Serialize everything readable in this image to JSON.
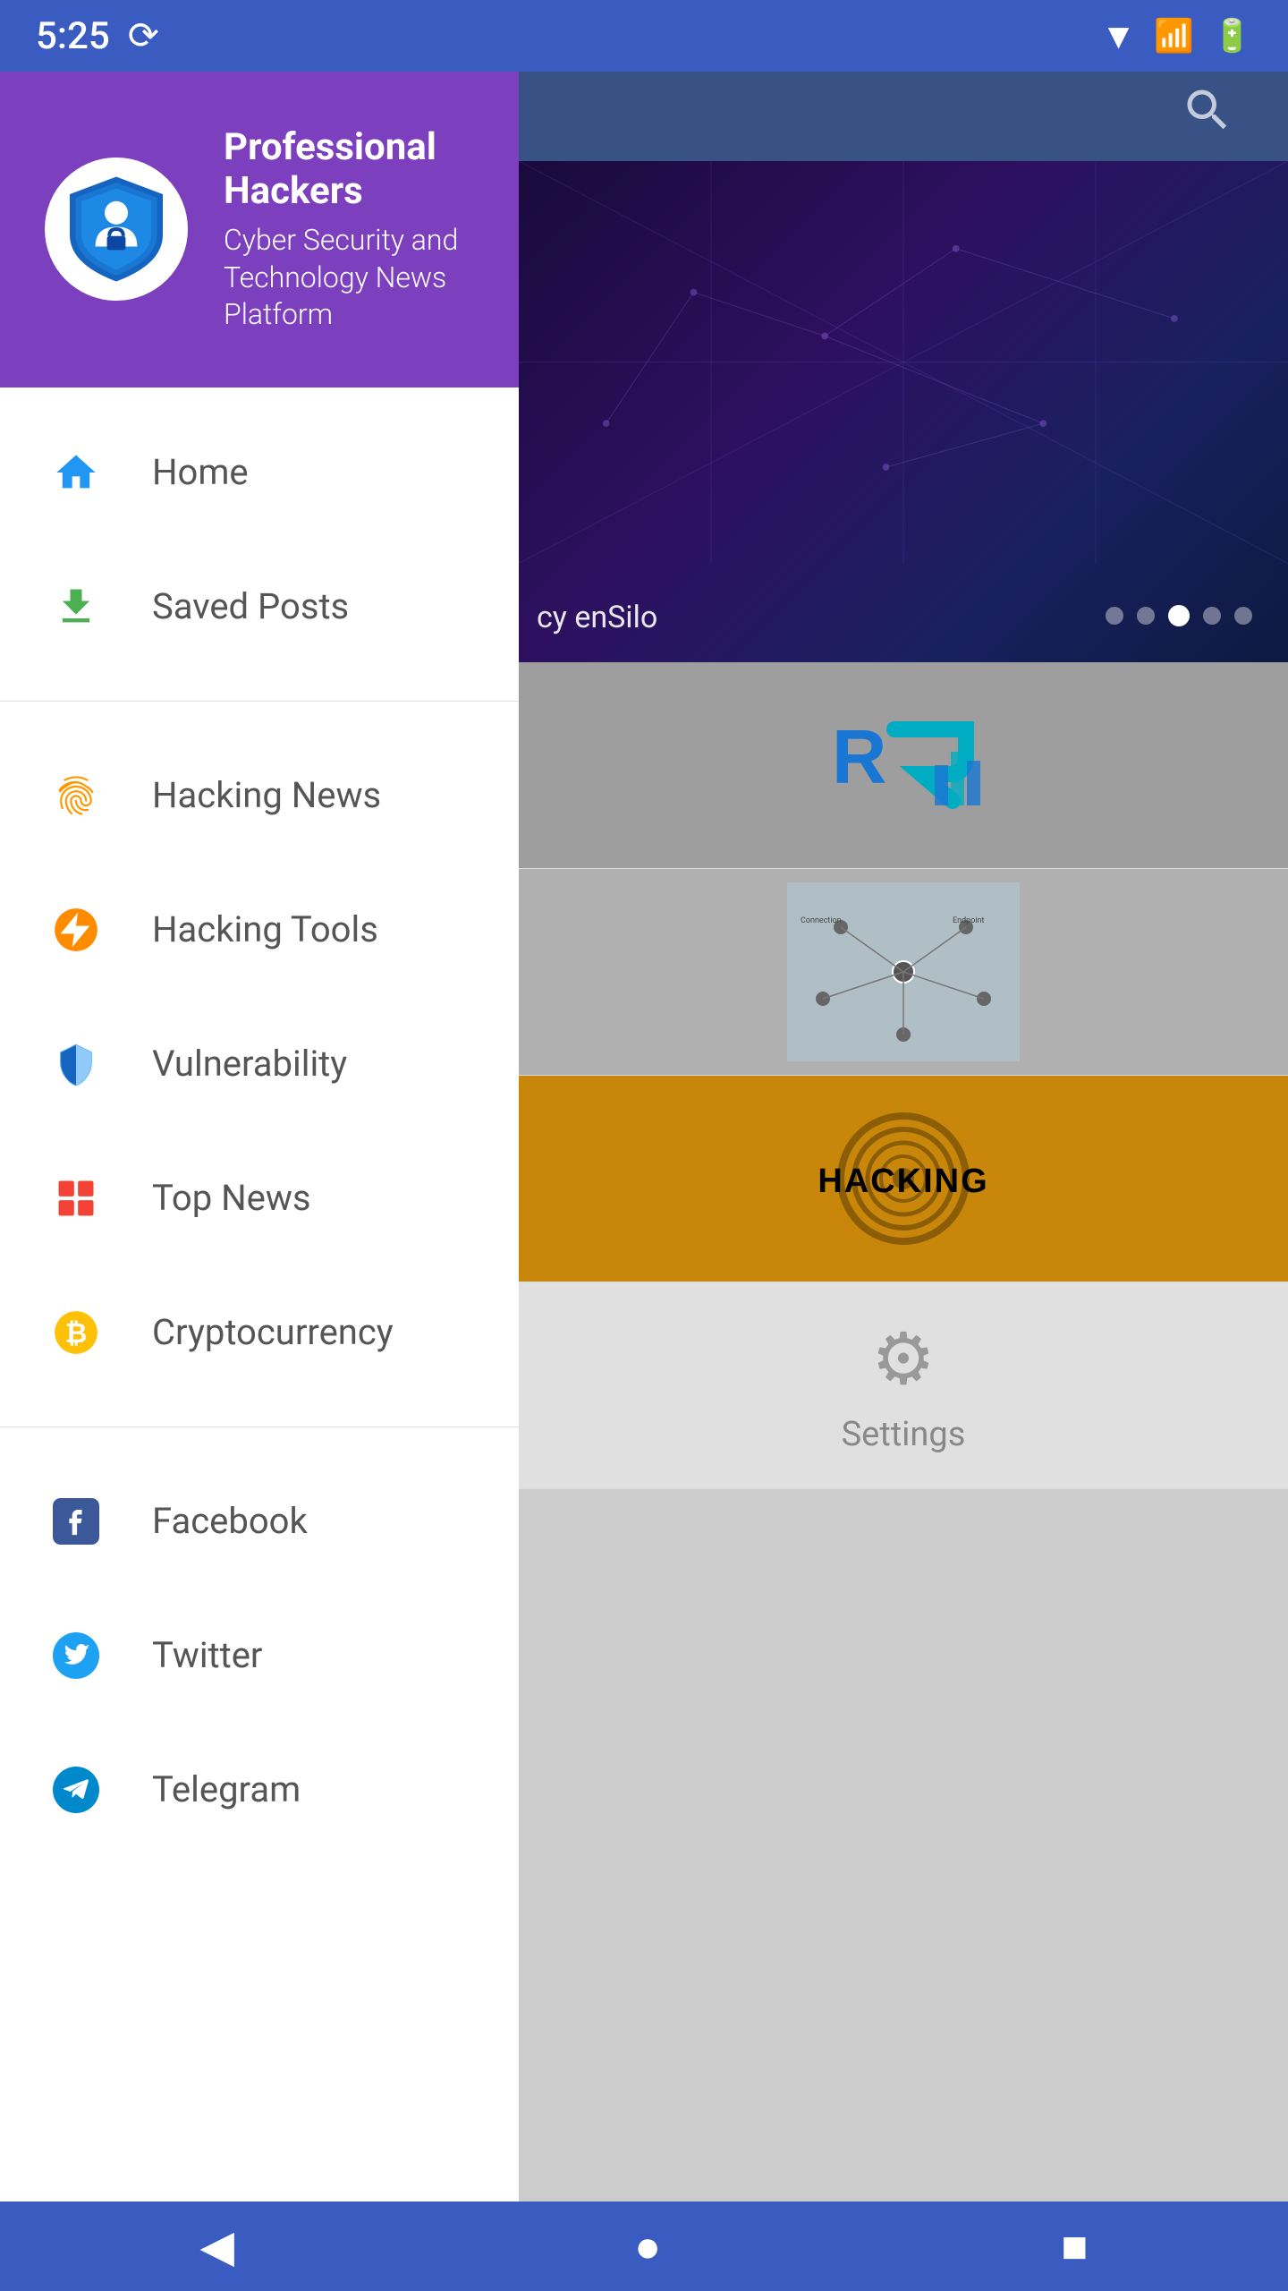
{
  "statusBar": {
    "time": "5:25",
    "icons": [
      "sync-icon",
      "wifi-icon",
      "signal-icon",
      "battery-icon"
    ]
  },
  "drawer": {
    "header": {
      "appName": "Professional Hackers",
      "subtitle": "Cyber Security and Technology News Platform"
    },
    "navItems": [
      {
        "id": "home",
        "label": "Home",
        "icon": "home",
        "color": "#2196F3"
      },
      {
        "id": "saved-posts",
        "label": "Saved Posts",
        "icon": "download",
        "color": "#4CAF50"
      }
    ],
    "categoryItems": [
      {
        "id": "hacking-news",
        "label": "Hacking News",
        "icon": "fingerprint",
        "color": "#FF9800"
      },
      {
        "id": "hacking-tools",
        "label": "Hacking Tools",
        "icon": "bolt",
        "color": "#FF5722"
      },
      {
        "id": "vulnerability",
        "label": "Vulnerability",
        "icon": "shield",
        "color": "#2196F3"
      },
      {
        "id": "top-news",
        "label": "Top News",
        "icon": "grid",
        "color": "#F44336"
      },
      {
        "id": "cryptocurrency",
        "label": "Cryptocurrency",
        "icon": "bitcoin",
        "color": "#FFC107"
      }
    ],
    "socialItems": [
      {
        "id": "facebook",
        "label": "Facebook",
        "icon": "facebook",
        "color": "#3b5998"
      },
      {
        "id": "twitter",
        "label": "Twitter",
        "icon": "twitter",
        "color": "#1da1f2"
      },
      {
        "id": "telegram",
        "label": "Telegram",
        "icon": "telegram",
        "color": "#0088cc"
      }
    ]
  },
  "content": {
    "heroCaption": "cy enSilo",
    "heroDots": 5,
    "activeHeroDot": 2,
    "cards": [
      {
        "type": "rt-logo",
        "alt": "RT Logo"
      },
      {
        "type": "network-diagram",
        "alt": "Network Diagram"
      },
      {
        "type": "hacking-text",
        "text": "HACKING"
      },
      {
        "type": "settings",
        "label": "Settings"
      }
    ]
  },
  "bottomNav": {
    "back": "◀",
    "home": "●",
    "recent": "■"
  }
}
